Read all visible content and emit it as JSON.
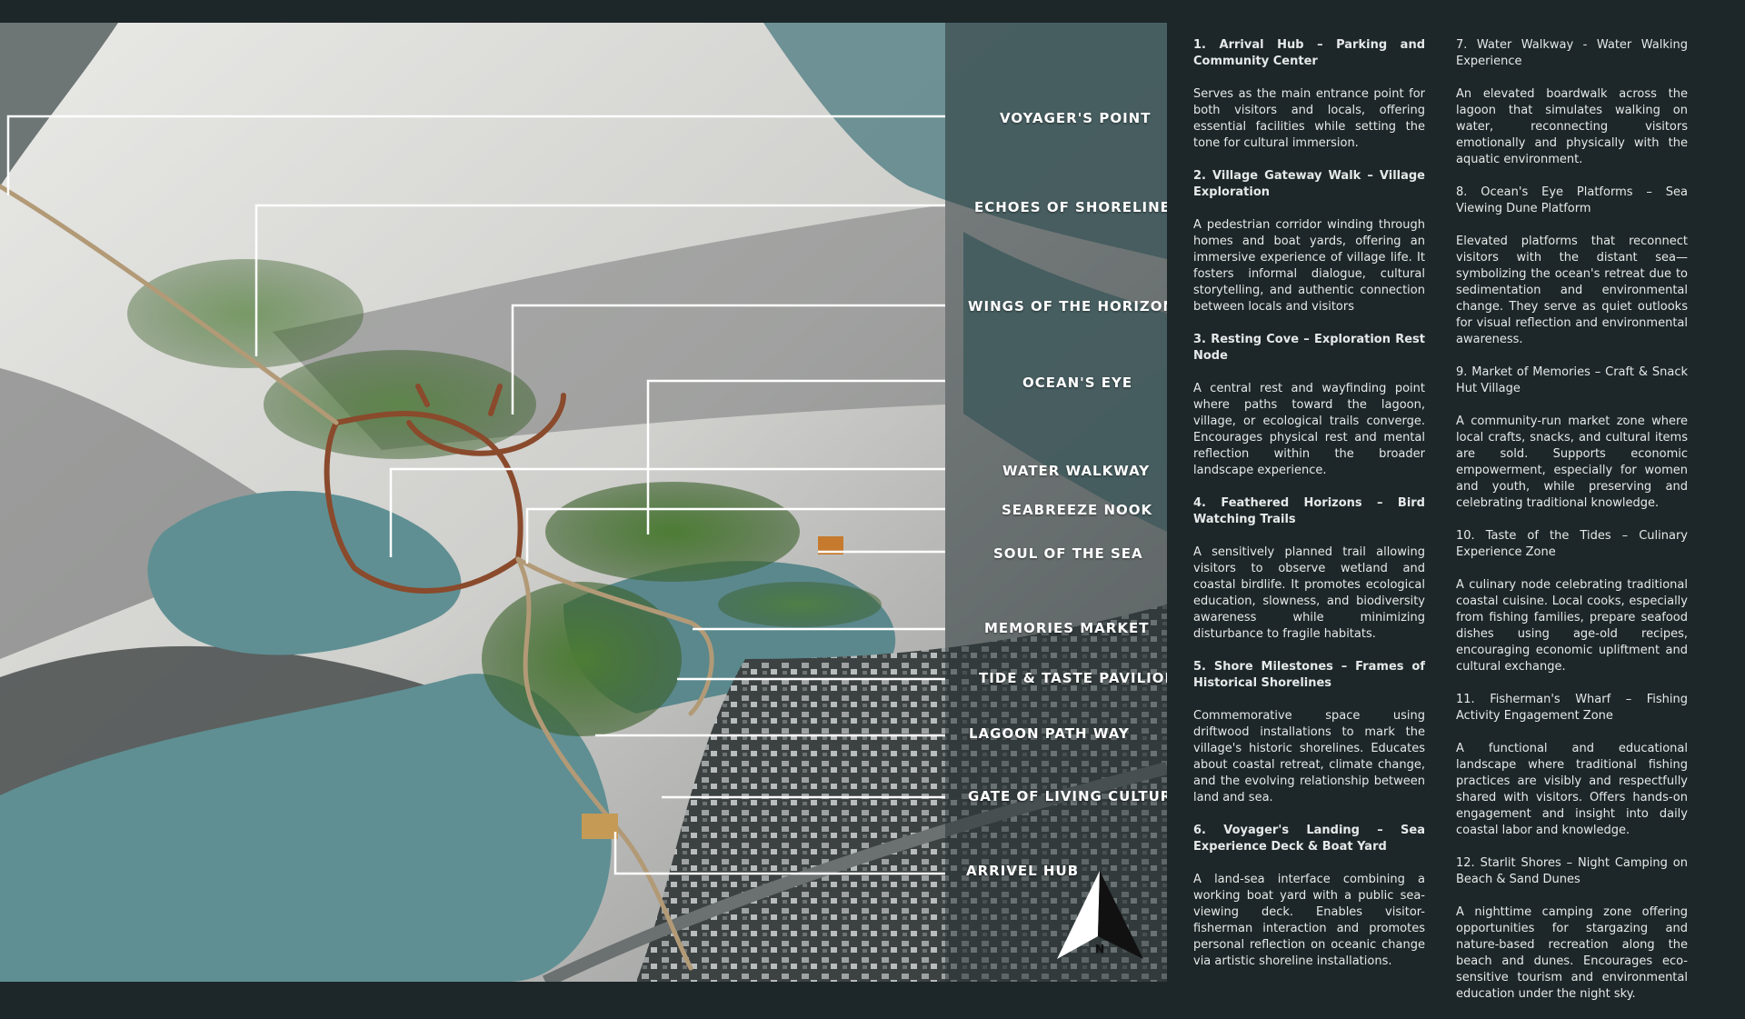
{
  "map": {
    "labels": [
      "VOYAGER'S POINT",
      "ECHOES OF SHORELINES",
      "WINGS OF THE HORIZON",
      "OCEAN'S EYE",
      "WATER WALKWAY",
      "SEABREEZE NOOK",
      "SOUL OF THE SEA",
      "MEMORIES MARKET",
      "TIDE & TASTE PAVILION",
      "LAGOON PATH WAY",
      "GATE OF LIVING CULTURE",
      "ARRIVEL HUB"
    ],
    "north_arrow_label": "N",
    "colors": {
      "sand": "#d9d9d6",
      "water": "#5f8f93",
      "vegetation": "#4f7d3a",
      "boardwalk": "#8a4a2c",
      "overlay": "#2a3436"
    }
  },
  "legend": {
    "column1": [
      {
        "title": "1. Arrival Hub – Parking and Community Center",
        "desc": "Serves as the main entrance point for both visitors and locals, offering essential facilities while setting the tone for cultural immersion."
      },
      {
        "title": "2. Village Gateway Walk – Village Exploration",
        "desc": " A pedestrian corridor winding through homes and boat yards, offering an immersive experience of village life. It fosters informal dialogue, cultural storytelling, and authentic connection between locals and visitors"
      },
      {
        "title": "3. Resting Cove – Exploration Rest Node",
        "desc": "  A central rest and wayfinding point where paths toward the lagoon, village, or ecological trails converge. Encourages physical rest and mental reflection within the broader landscape experience."
      },
      {
        "title": "4. Feathered Horizons – Bird Watching Trails",
        "desc": "  A sensitively planned trail allowing visitors to observe wetland and coastal birdlife. It promotes ecological education, slowness, and biodiversity awareness while minimizing disturbance to fragile habitats."
      },
      {
        "title": "5. Shore Milestones – Frames of Historical Shorelines",
        "desc": "Commemorative space using driftwood installations to mark the village's historic shorelines. Educates about coastal retreat, climate change, and the evolving relationship between land and sea."
      },
      {
        "title": "6. Voyager's Landing – Sea Experience Deck & Boat Yard",
        "desc": "  A land-sea interface combining a working boat yard with a public sea-viewing deck. Enables visitor-fisherman interaction and promotes personal reflection on oceanic change via artistic shoreline installations."
      }
    ],
    "column2": [
      {
        "title": "7. Water Walkway - Water Walking Experience",
        "desc": "An elevated boardwalk across the lagoon that simulates walking on water, reconnecting visitors emotionally and physically with the aquatic environment."
      },
      {
        "title": "8. Ocean's Eye Platforms – Sea Viewing Dune Platform",
        "desc": "Elevated platforms that reconnect visitors with the distant sea—symbolizing the ocean's retreat due to sedimentation and environmental change. They serve as quiet outlooks for visual reflection and environmental awareness."
      },
      {
        "title": "9. Market of Memories – Craft & Snack Hut Village",
        "desc": "A community-run market zone where local crafts, snacks, and cultural items are sold. Supports economic empowerment, especially for women and youth, while preserving and celebrating traditional knowledge."
      },
      {
        "title": "10. Taste of the Tides – Culinary Experience Zone",
        "desc": "A culinary node celebrating traditional coastal cuisine. Local cooks, especially from fishing families, prepare seafood dishes using age-old recipes, encouraging economic upliftment and cultural exchange."
      },
      {
        "title": "11. Fisherman's Wharf – Fishing Activity Engagement Zone",
        "desc": "A functional and educational landscape where traditional fishing practices are visibly and respectfully shared with visitors. Offers hands-on engagement and insight into daily coastal labor and knowledge."
      },
      {
        "title": "12. Starlit Shores – Night Camping on Beach & Sand Dunes",
        "desc": "A nighttime camping zone offering opportunities for stargazing and nature-based recreation along the beach and dunes. Encourages eco-sensitive tourism and environmental education under the night sky."
      }
    ]
  }
}
